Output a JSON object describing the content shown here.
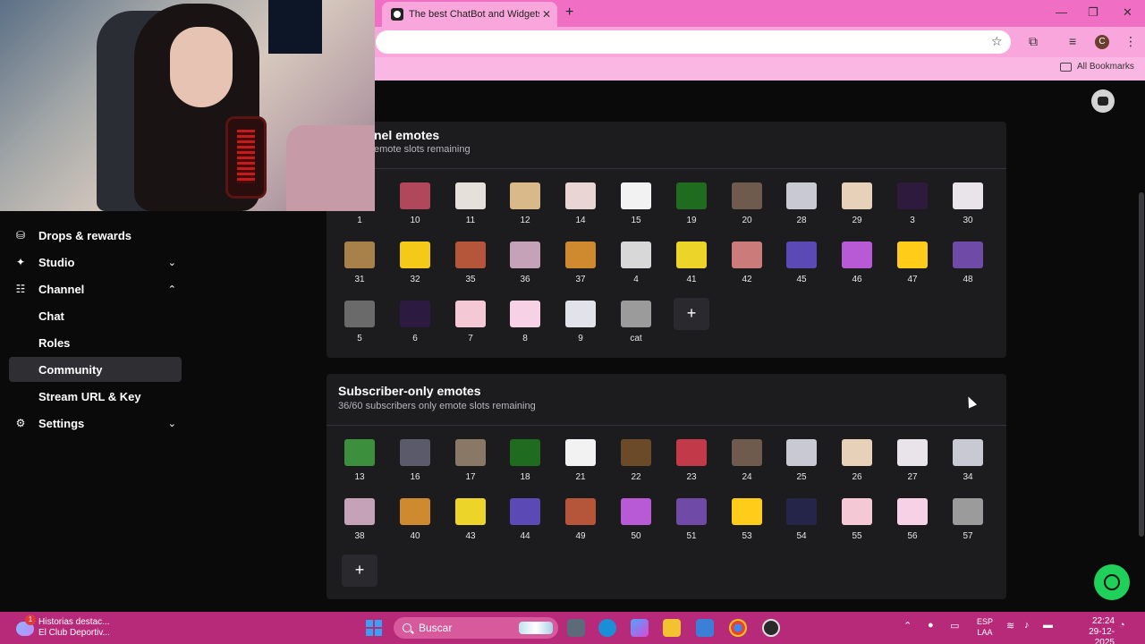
{
  "browser": {
    "tab_title": "The best ChatBot and Widgets",
    "tab_close": "✕",
    "new_tab": "+",
    "profile_initial": "C",
    "bookmarks_label": "All Bookmarks"
  },
  "sidebar": {
    "items": [
      {
        "label": "Drops & rewards",
        "icon": "drops-icon"
      },
      {
        "label": "Studio",
        "icon": "studio-icon",
        "chevron": "down"
      },
      {
        "label": "Channel",
        "icon": "channel-icon",
        "chevron": "up"
      },
      {
        "label": "Chat"
      },
      {
        "label": "Roles"
      },
      {
        "label": "Community",
        "active": true
      },
      {
        "label": "Stream URL & Key"
      },
      {
        "label": "Settings",
        "icon": "gear-icon",
        "chevron": "down"
      }
    ]
  },
  "channel_emotes": {
    "title": "nel emotes",
    "subtitle": "emote slots remaining",
    "emotes": [
      "1",
      "10",
      "11",
      "12",
      "14",
      "15",
      "19",
      "20",
      "28",
      "29",
      "3",
      "30",
      "31",
      "32",
      "35",
      "36",
      "37",
      "4",
      "41",
      "42",
      "45",
      "46",
      "47",
      "48",
      "5",
      "6",
      "7",
      "8",
      "9",
      "cat"
    ],
    "colors": [
      "#6b5f5a",
      "#b0475a",
      "#e5e0da",
      "#d9b98a",
      "#e9d6d4",
      "#f2f2f2",
      "#1f6b1f",
      "#6e5b4e",
      "#c9c9d4",
      "#e8d1b9",
      "#2d1a3d",
      "#e9e4ea",
      "#a8814a",
      "#f5c918",
      "#b5553a",
      "#c6a2b8",
      "#cf8a2f",
      "#d8d8d8",
      "#ecd428",
      "#cc7b7b",
      "#5b4ab5",
      "#b85ad6",
      "#ffcc1a",
      "#6f4aa6",
      "#6a6a6a",
      "#2d1a40",
      "#f5c8d6",
      "#f7d2e6",
      "#e2e2ea",
      "#9b9b9b"
    ]
  },
  "subscriber_emotes": {
    "title": "Subscriber-only emotes",
    "subtitle": "36/60 subscribers only emote slots remaining",
    "emotes": [
      "13",
      "16",
      "17",
      "18",
      "21",
      "22",
      "23",
      "24",
      "25",
      "26",
      "27",
      "34",
      "38",
      "40",
      "43",
      "44",
      "49",
      "50",
      "51",
      "53",
      "54",
      "55",
      "56",
      "57"
    ],
    "colors": [
      "#3c8f3c",
      "#5a5a6a",
      "#8a7866",
      "#1f6b1f",
      "#f2f2f2",
      "#6b4a2a",
      "#c23a4a",
      "#6e5b4e",
      "#c9c9d4",
      "#e8d1b9",
      "#e9e4ea",
      "#c9c9d4",
      "#c6a2b8",
      "#cf8a2f",
      "#ecd428",
      "#5b4ab5",
      "#b5553a",
      "#b85ad6",
      "#6f4aa6",
      "#ffcc1a",
      "#25254a",
      "#f5c8d6",
      "#f7d2e6",
      "#9b9b9b"
    ]
  },
  "add_label": "+",
  "taskbar": {
    "news_title": "Historias destac...",
    "news_sub": "El Club Deportiv...",
    "news_badge": "1",
    "search_label": "Buscar",
    "lang_line1": "ESP",
    "lang_line2": "LAA",
    "time": "22:24",
    "date": "29-12-2025"
  }
}
